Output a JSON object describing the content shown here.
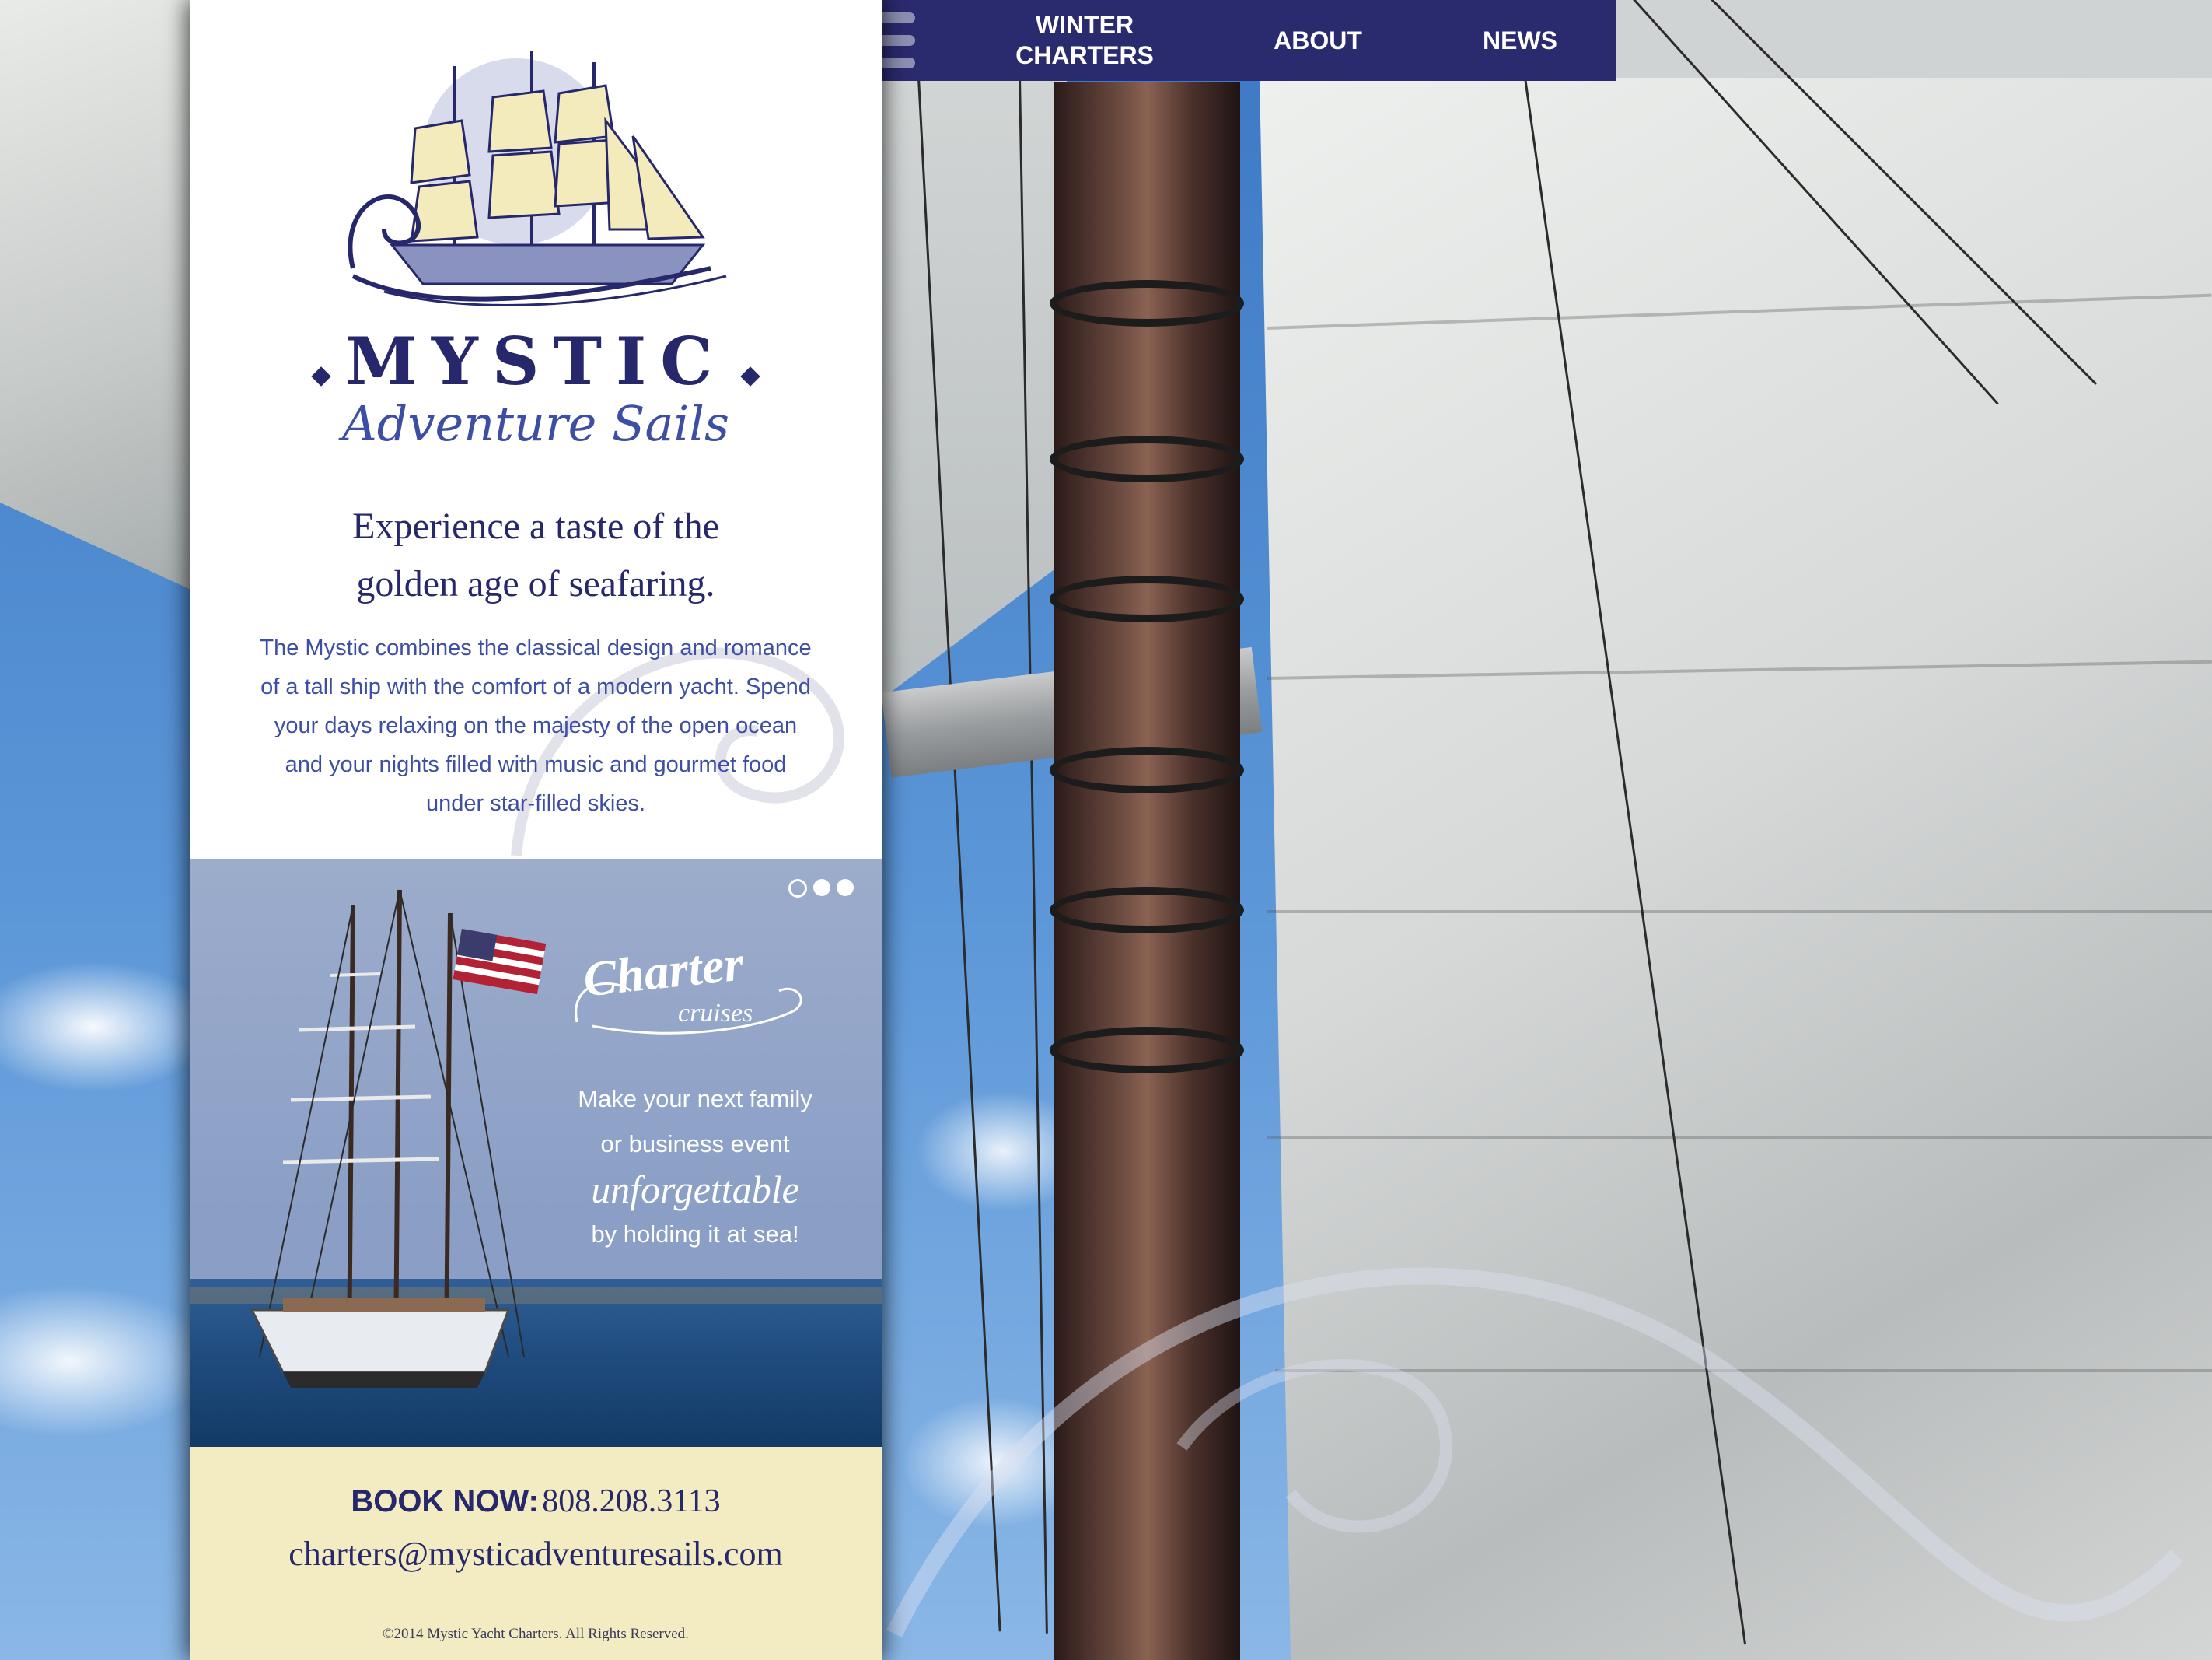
{
  "nav": {
    "menu_icon": "hamburger-menu-icon",
    "links": [
      {
        "label": "WINTER\nCHARTERS"
      },
      {
        "label": "ABOUT"
      },
      {
        "label": "NEWS"
      }
    ]
  },
  "brand": {
    "name": "MYSTIC",
    "sub": "Adventure Sails",
    "logo_icon": "tall-ship-logo-icon"
  },
  "intro": {
    "headline_line1": "Experience a taste of the",
    "headline_line2": "golden age of seafaring.",
    "body": "The Mystic combines the classical design and romance of a tall ship with the comfort of a modern yacht. Spend your days relaxing on the majesty of the open ocean and your nights filled with music and gourmet food under star-filled skies."
  },
  "slide": {
    "title_big": "Charter",
    "title_small": "cruises",
    "line1": "Make your next family",
    "line2": "or business event",
    "line3": "unforgettable",
    "line4": "by holding it at sea!",
    "dots": [
      "hollow",
      "filled",
      "filled"
    ]
  },
  "footer": {
    "book_label": "BOOK NOW:",
    "phone": "808.208.3113",
    "email": "charters@mysticadventuresails.com",
    "copyright": "©2014 Mystic Yacht Charters. All Rights Reserved."
  },
  "colors": {
    "navy": "#27276b",
    "nav_bg": "#2a2a6e",
    "accent_blue": "#3e4ea3",
    "footer_bg": "#f3ecc2",
    "sail_cream": "#f4ebbd"
  }
}
